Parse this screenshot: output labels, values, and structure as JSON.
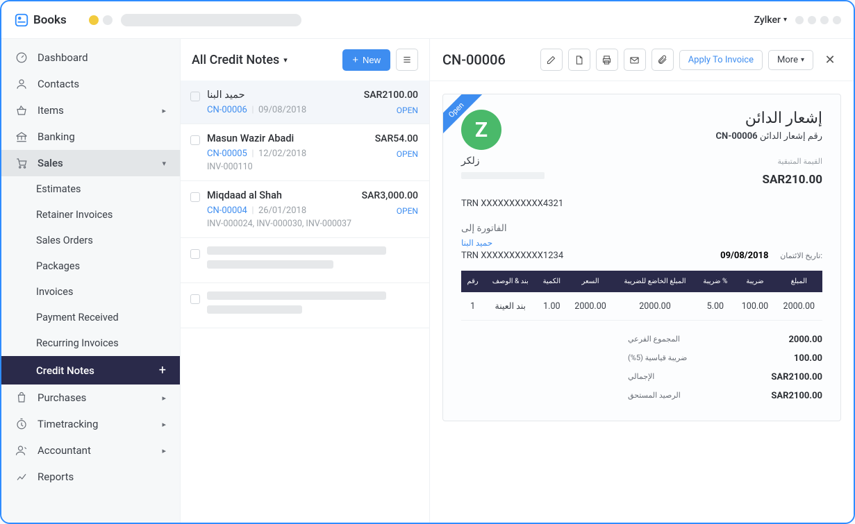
{
  "app": {
    "name": "Books",
    "org": "Zylker"
  },
  "sidebar": {
    "dashboard": "Dashboard",
    "contacts": "Contacts",
    "items": "Items",
    "banking": "Banking",
    "sales": "Sales",
    "estimates": "Estimates",
    "retainer": "Retainer Invoices",
    "salesorders": "Sales Orders",
    "packages": "Packages",
    "invoices": "Invoices",
    "payment": "Payment Received",
    "recurring": "Recurring Invoices",
    "creditnotes": "Credit Notes",
    "purchases": "Purchases",
    "timetracking": "Timetracking",
    "accountant": "Accountant",
    "reports": "Reports"
  },
  "list": {
    "title": "All Credit Notes",
    "newLabel": "New",
    "rows": [
      {
        "name": "حميد البنا",
        "amount": "SAR2100.00",
        "cn": "CN-00006",
        "date": "09/08/2018",
        "status": "OPEN",
        "inv": ""
      },
      {
        "name": "Masun Wazir Abadi",
        "amount": "SAR54.00",
        "cn": "CN-00005",
        "date": "12/02/2018",
        "status": "OPEN",
        "inv": "INV-000110"
      },
      {
        "name": "Miqdaad al Shah",
        "amount": "SAR3,000.00",
        "cn": "CN-00004",
        "date": "26/01/2018",
        "status": "OPEN",
        "inv": "INV-000024, INV-000030, INV-000037"
      }
    ]
  },
  "detail": {
    "title": "CN-00006",
    "applyLabel": "Apply To Invoice",
    "moreLabel": "More",
    "ribbon": "Open",
    "company": "زلكر",
    "companyTrn": "TRN XXXXXXXXXXX4321",
    "heading": "رقم إشعار الدائن",
    "cnno": "CN-00006",
    "balanceLabel": "القيمة المتبقية",
    "balance": "SAR210.00",
    "billLabel": "الفاتورة إلى",
    "custName": "حميد البنا",
    "custTrn": "TRN XXXXXXXXXXX1234",
    "dateLabel": "تاريخ الائتمان:",
    "dateVal": "09/08/2018",
    "table": {
      "headers": [
        "رقم",
        "بند & الوصف",
        "الكمية",
        "السعر",
        "المبلغ الخاضع للضريبة",
        "ضريبة %",
        "ضريبة",
        "المبلغ"
      ],
      "row": [
        "1",
        "بند العينة",
        "1.00",
        "2000.00",
        "2000.00",
        "5.00",
        "100.00",
        "2000.00"
      ]
    },
    "totals": {
      "subtotalLabel": "المجموع الفرعي",
      "subtotalVal": "2000.00",
      "taxLabel": "ضريبة قياسية (5%)",
      "taxVal": "100.00",
      "totalLabel": "الإجمالي",
      "totalVal": "SAR2100.00",
      "dueLabel": "الرصيد المستحق",
      "dueVal": "SAR2100.00"
    }
  }
}
